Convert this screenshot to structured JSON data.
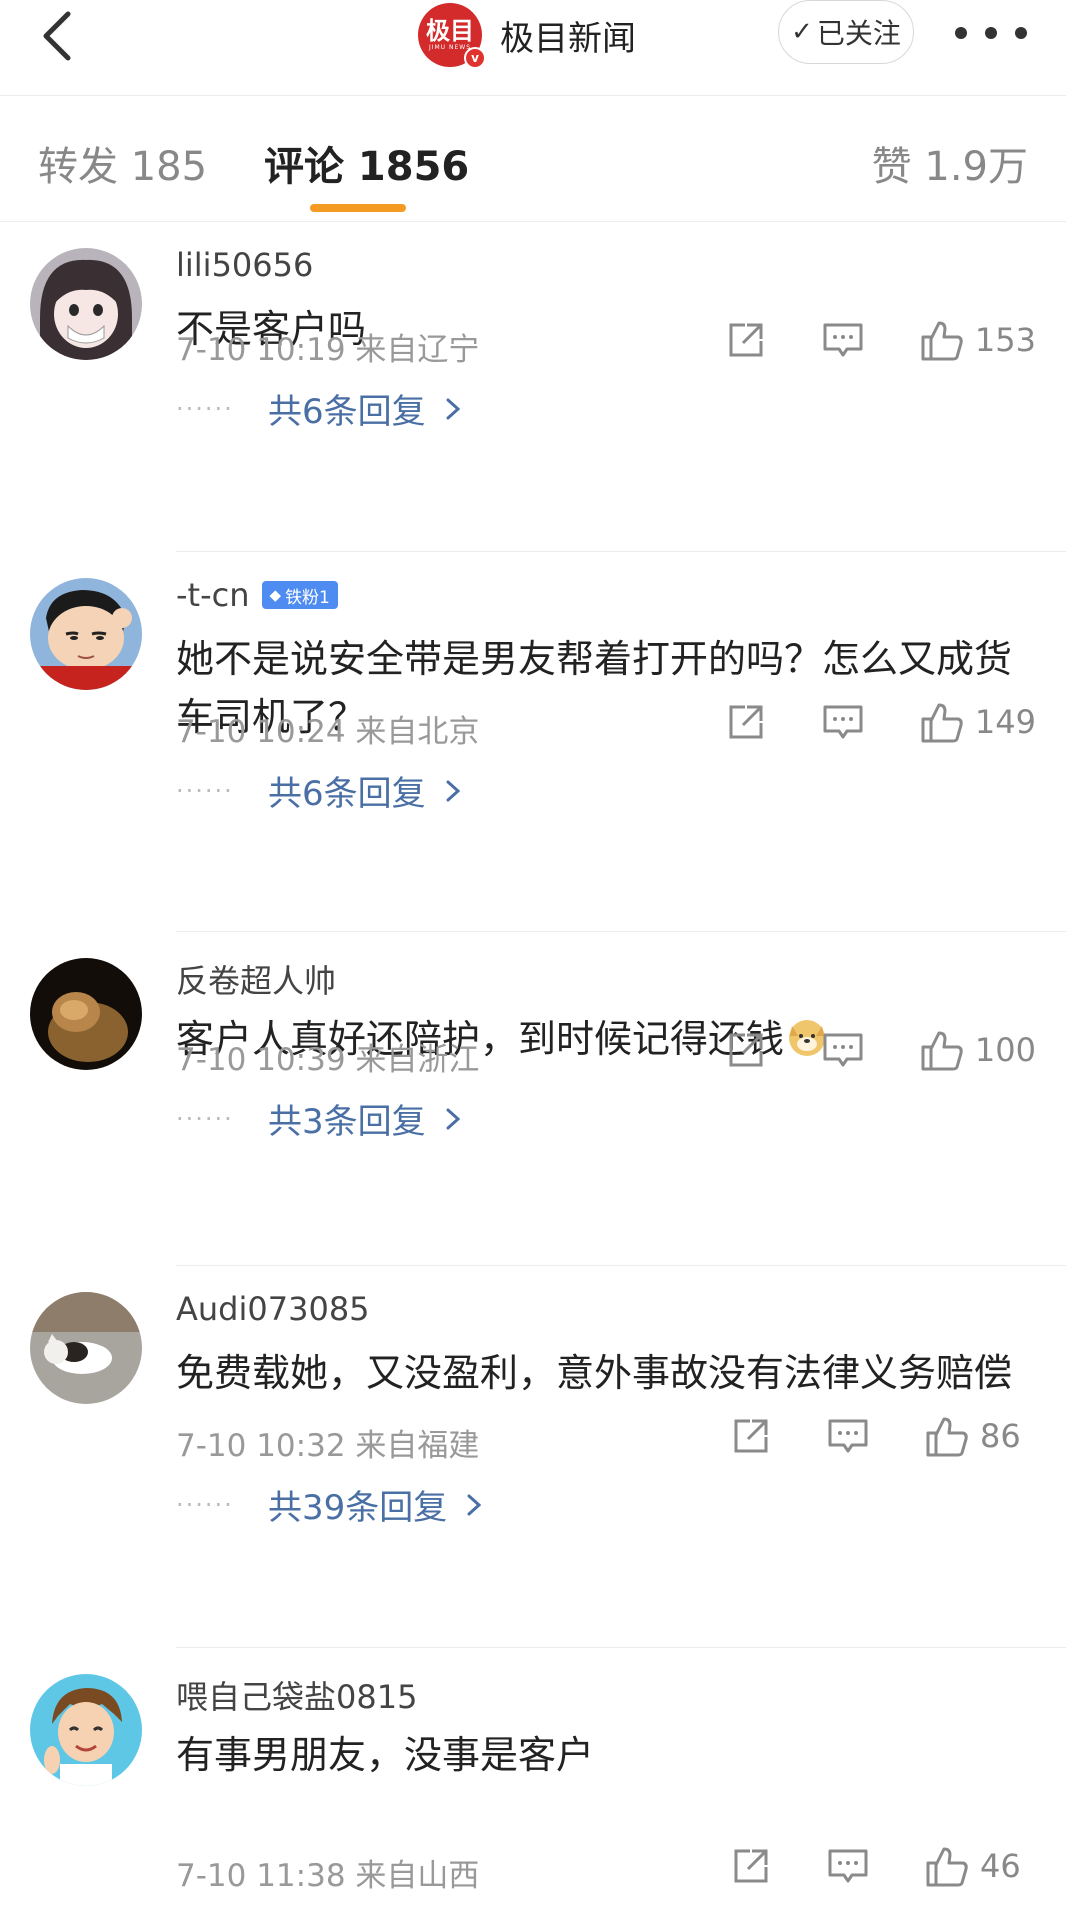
{
  "header": {
    "brand_logo_text": "极目",
    "brand_logo_sub": "JIMU NEWS",
    "brand_name": "极目新闻",
    "follow_label": "已关注"
  },
  "tabs": {
    "repost": "转发 185",
    "comments": "评论 1856",
    "likes": "赞 1.9万"
  },
  "comments": [
    {
      "username": "lili50656",
      "badge": "",
      "text": "不是客户吗",
      "meta": "7-10 10:19  来自辽宁",
      "likes": "153",
      "replies": "共6条回复"
    },
    {
      "username": "-t-cn",
      "badge": "铁粉1",
      "text": "她不是说安全带是男友帮着打开的吗？怎么又成货车司机了？",
      "meta": "7-10 10:24  来自北京",
      "likes": "149",
      "replies": "共6条回复"
    },
    {
      "username": "反卷超人帅",
      "badge": "",
      "text": "客户人真好还陪护，到时候记得还钱",
      "meta": "7-10 10:39  来自浙江",
      "likes": "100",
      "replies": "共3条回复"
    },
    {
      "username": "Audi073085",
      "badge": "",
      "text": "免费载她，又没盈利，意外事故没有法律义务赔偿",
      "meta": "7-10 10:32  来自福建",
      "likes": "86",
      "replies": "共39条回复"
    },
    {
      "username": "喂自己袋盐0815",
      "badge": "",
      "text": "有事男朋友，没事是客户",
      "meta": "7-10 11:38  来自山西",
      "likes": "46",
      "replies": ""
    }
  ]
}
